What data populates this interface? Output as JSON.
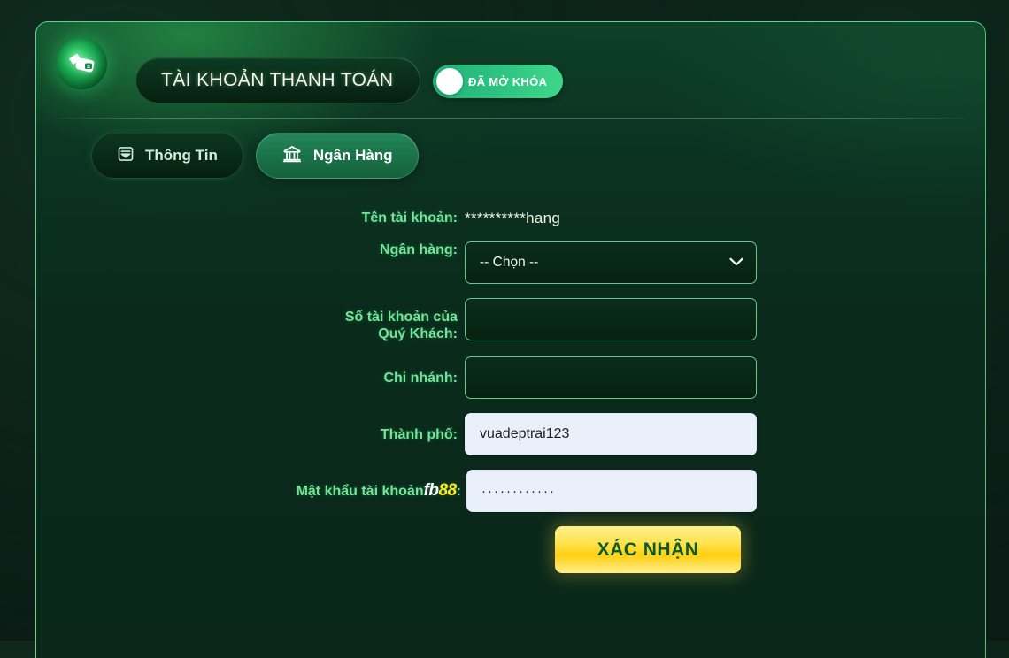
{
  "header": {
    "wallet_icon": "wallet-hand-icon",
    "title": "TÀI KHOẢN THANH TOÁN",
    "lock_badge": {
      "label": "ĐÃ MỞ KHÓA",
      "knob_icon": "toggle-knob-icon"
    }
  },
  "tabs": [
    {
      "label": "Thông Tin",
      "icon": "inbox-icon",
      "active": false
    },
    {
      "label": "Ngân Hàng",
      "icon": "bank-icon",
      "active": true
    }
  ],
  "form": {
    "account_name": {
      "label": "Tên tài khoản:",
      "value": "**********hang"
    },
    "bank": {
      "label": "Ngân hàng:",
      "selected": "-- Chọn --",
      "chevron_icon": "chevron-down-icon"
    },
    "account_number": {
      "label_line1": "Số tài khoản của",
      "label_line2": "Quý Khách:",
      "value": "",
      "placeholder": ""
    },
    "branch": {
      "label": "Chi nhánh:",
      "value": "",
      "placeholder": ""
    },
    "city": {
      "label": "Thành phố:",
      "value": "vuadeptrai123",
      "placeholder": ""
    },
    "password": {
      "label_prefix": "Mật khẩu tài khoản ",
      "brand_fb": "fb",
      "brand_88": "88",
      "label_suffix": ":",
      "value": "············",
      "placeholder": ""
    },
    "confirm_button": "XÁC NHẬN"
  },
  "colors": {
    "accent_green": "#75e49a",
    "card_border": "#5fd38a",
    "button_gold": "#ffcf10",
    "button_text": "#0d5a2c",
    "brand_yellow": "#ffe81f",
    "badge_green": "#2bc07f"
  }
}
